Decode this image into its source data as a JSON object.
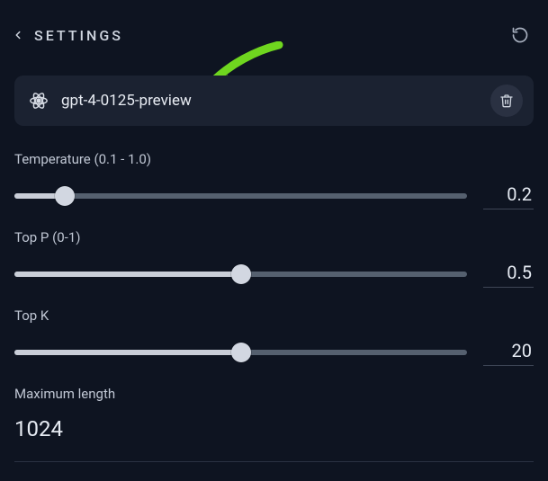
{
  "header": {
    "title": "SETTINGS",
    "back_icon": "chevron-left",
    "refresh_icon": "refresh"
  },
  "model": {
    "icon": "atom-icon",
    "name": "gpt-4-0125-preview",
    "delete_icon": "trash-icon"
  },
  "annotation": {
    "arrow_color": "#6fd61f"
  },
  "params": {
    "temperature": {
      "label": "Temperature (0.1 - 1.0)",
      "min": 0.1,
      "max": 1.0,
      "value": 0.2,
      "display": "0.2"
    },
    "top_p": {
      "label": "Top P (0-1)",
      "min": 0,
      "max": 1,
      "value": 0.5,
      "display": "0.5"
    },
    "top_k": {
      "label": "Top K",
      "min": 0,
      "max": 40,
      "value": 20,
      "display": "20"
    },
    "max_length": {
      "label": "Maximum length",
      "value": 1024,
      "display": "1024"
    }
  }
}
